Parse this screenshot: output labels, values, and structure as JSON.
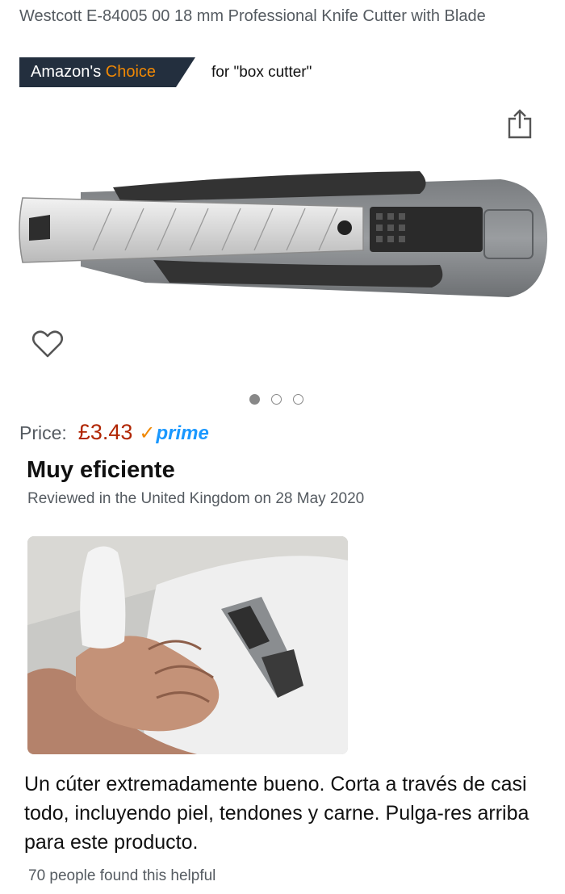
{
  "product": {
    "title": "Westcott E-84005 00 18 mm Professional Knife Cutter with Blade"
  },
  "badge": {
    "prefix": "Amazon's ",
    "highlight": "Choice",
    "for_text": "for \"box cutter\""
  },
  "icons": {
    "share": "share-icon",
    "wishlist": "heart-icon",
    "prime_check": "checkmark-icon"
  },
  "carousel": {
    "count": 3,
    "active_index": 0
  },
  "price": {
    "label": "Price:",
    "value": "£3.43",
    "prime_label": "prime"
  },
  "review": {
    "title": "Muy eficiente",
    "meta": "Reviewed in the United Kingdom on 28 May 2020",
    "body": "Un cúter extremadamente bueno. Corta a través de casi todo, incluyendo piel, tendones y carne. Pulga-res arriba para este producto.",
    "helpful": "70 people found this helpful"
  },
  "colors": {
    "badge_bg": "#232f3e",
    "badge_accent": "#f08804",
    "price": "#b12704",
    "prime": "#1a98ff"
  }
}
